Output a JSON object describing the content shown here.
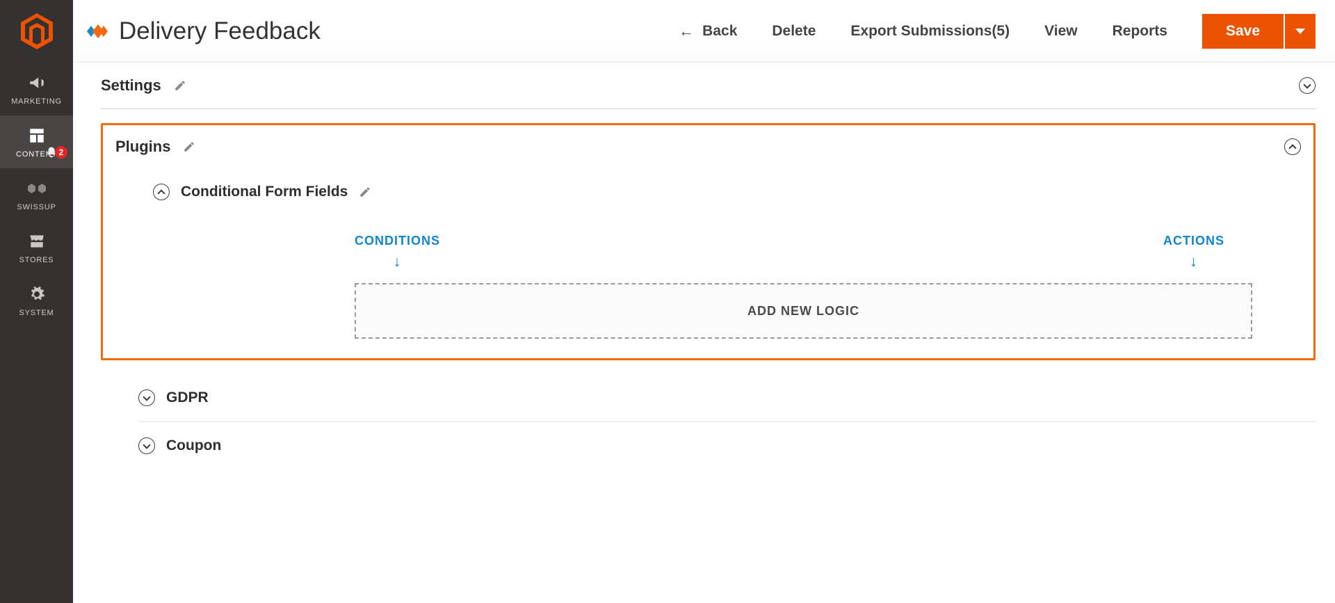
{
  "sidebar": {
    "items": [
      {
        "label": "MARKETING",
        "icon": "megaphone"
      },
      {
        "label": "CONTENT",
        "icon": "layout",
        "active": true,
        "badge": "2"
      },
      {
        "label": "SWISSUP",
        "icon": "hexagons"
      },
      {
        "label": "STORES",
        "icon": "storefront"
      },
      {
        "label": "SYSTEM",
        "icon": "gear"
      }
    ]
  },
  "header": {
    "title": "Delivery Feedback",
    "back": "Back",
    "delete": "Delete",
    "export": "Export Submissions(5)",
    "view": "View",
    "reports": "Reports",
    "save": "Save"
  },
  "sections": {
    "settings": {
      "title": "Settings"
    },
    "plugins": {
      "title": "Plugins",
      "conditional": {
        "title": "Conditional Form Fields",
        "conditions_label": "CONDITIONS",
        "actions_label": "ACTIONS",
        "add_button": "ADD NEW LOGIC"
      },
      "gdpr": {
        "title": "GDPR"
      },
      "coupon": {
        "title": "Coupon"
      }
    }
  },
  "colors": {
    "accent": "#eb5202",
    "link": "#0f85d1",
    "sidebar_bg": "#353130"
  }
}
